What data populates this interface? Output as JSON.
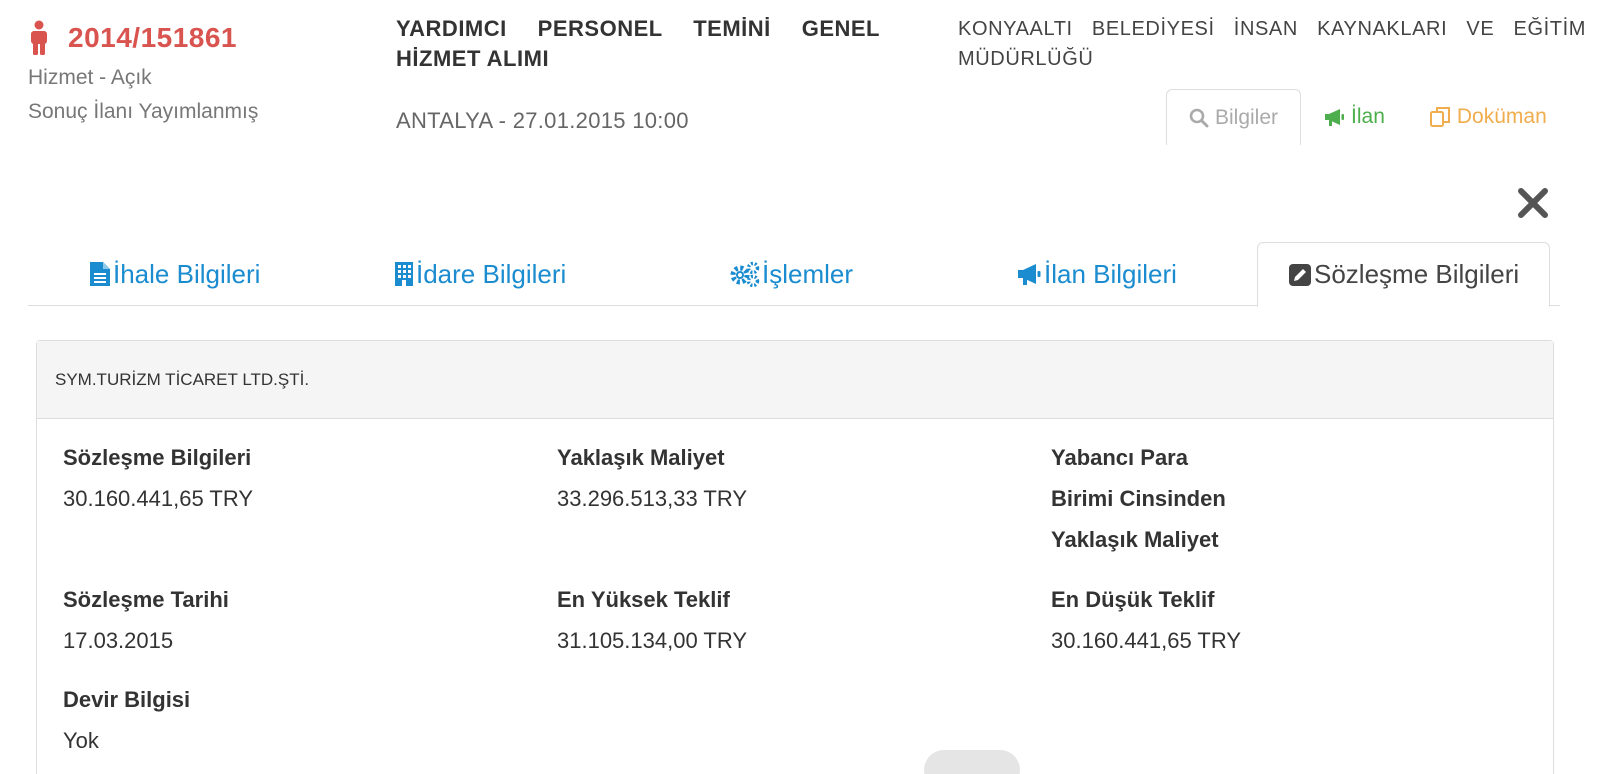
{
  "header": {
    "ikn": "2014/151861",
    "type_status": "Hizmet - Açık",
    "result_status": "Sonuç İlanı Yayımlanmış",
    "title": "YARDIMCI PERSONEL TEMİNİ GENEL HİZMET ALIMI",
    "city_date": "ANTALYA - 27.01.2015 10:00",
    "administration": "KONYAALTI BELEDİYESİ İNSAN KAYNAKLARI VE EĞİTİM MÜDÜRLÜĞÜ",
    "tabs": [
      {
        "label": "Bilgiler",
        "icon": "search-icon",
        "color": "#aaaaaa",
        "active": true
      },
      {
        "label": "İlan",
        "icon": "bullhorn-icon",
        "color": "#4cae4c"
      },
      {
        "label": "Doküman",
        "icon": "copy-icon",
        "color": "#f0ad4e"
      }
    ]
  },
  "tabs": [
    {
      "label": "İhale Bilgileri",
      "icon": "file-icon"
    },
    {
      "label": "İdare Bilgileri",
      "icon": "building-icon"
    },
    {
      "label": "İşlemler",
      "icon": "gears-icon"
    },
    {
      "label": "İlan Bilgileri",
      "icon": "bullhorn-icon"
    },
    {
      "label": "Sözleşme Bilgileri",
      "icon": "edit-icon",
      "active": true
    }
  ],
  "contract": {
    "company": "SYM.TURİZM TİCARET LTD.ŞTİ.",
    "fields": {
      "contract_amount": {
        "label": "Sözleşme Bilgileri",
        "value": "30.160.441,65 TRY"
      },
      "approx_cost": {
        "label": "Yaklaşık Maliyet",
        "value": "33.296.513,33 TRY"
      },
      "foreign_cost": {
        "label": "Yabancı Para Birimi Cinsinden Yaklaşık Maliyet",
        "value": ""
      },
      "contract_date": {
        "label": "Sözleşme Tarihi",
        "value": "17.03.2015"
      },
      "highest_bid": {
        "label": "En Yüksek Teklif",
        "value": "31.105.134,00 TRY"
      },
      "lowest_bid": {
        "label": "En Düşük Teklif",
        "value": "30.160.441,65 TRY"
      },
      "transfer": {
        "label": "Devir Bilgisi",
        "value": "Yok"
      }
    }
  },
  "colors": {
    "accent_red": "#d9534f",
    "link_blue": "#1a8ccf",
    "green": "#4cae4c",
    "orange": "#f0ad4e"
  }
}
